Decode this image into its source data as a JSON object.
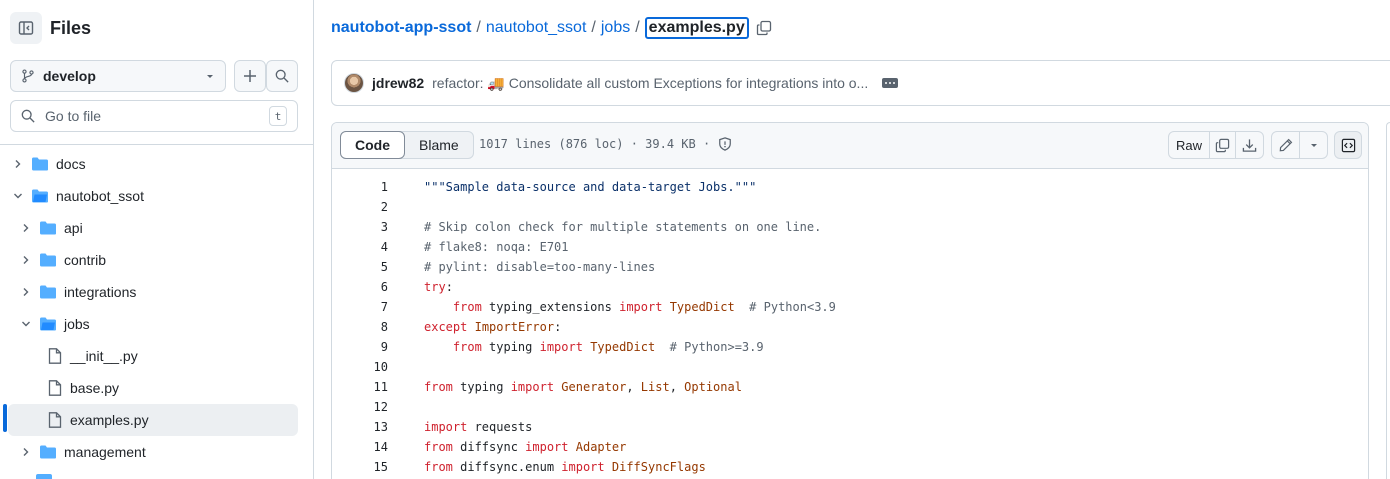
{
  "sidebar": {
    "title": "Files",
    "branch": "develop",
    "search_placeholder": "Go to file",
    "search_shortcut": "t",
    "tree": [
      {
        "label": "docs",
        "type": "folder",
        "expanded": false,
        "depth": 0
      },
      {
        "label": "nautobot_ssot",
        "type": "folder",
        "expanded": true,
        "depth": 0
      },
      {
        "label": "api",
        "type": "folder",
        "expanded": false,
        "depth": 1
      },
      {
        "label": "contrib",
        "type": "folder",
        "expanded": false,
        "depth": 1
      },
      {
        "label": "integrations",
        "type": "folder",
        "expanded": false,
        "depth": 1
      },
      {
        "label": "jobs",
        "type": "folder",
        "expanded": true,
        "depth": 1
      },
      {
        "label": "__init__.py",
        "type": "file",
        "depth": 2
      },
      {
        "label": "base.py",
        "type": "file",
        "depth": 2
      },
      {
        "label": "examples.py",
        "type": "file",
        "depth": 2,
        "selected": true
      },
      {
        "label": "management",
        "type": "folder",
        "expanded": false,
        "depth": 1
      }
    ]
  },
  "breadcrumb": {
    "repo": "nautobot-app-ssot",
    "sep": "/",
    "parts": [
      "nautobot_ssot",
      "jobs"
    ],
    "current": "examples.py"
  },
  "commit": {
    "author": "jdrew82",
    "message": "refactor: 🚚 Consolidate all custom Exceptions for integrations into o..."
  },
  "code_header": {
    "tab_code": "Code",
    "tab_blame": "Blame",
    "file_info": "1017 lines (876 loc) · 39.4 KB ·",
    "raw_label": "Raw"
  },
  "colors": {
    "accent": "#0969da",
    "keyword": "#cf222e",
    "class_name": "#953800",
    "string": "#0a3069",
    "comment": "#59636e"
  },
  "code": {
    "line_numbers": [
      "1",
      "2",
      "3",
      "4",
      "5",
      "6",
      "7",
      "8",
      "9",
      "10",
      "11",
      "12",
      "13",
      "14",
      "15"
    ],
    "lines": [
      [
        {
          "t": "\"\"\"Sample data-source and data-target Jobs.\"\"\"",
          "c": "str"
        }
      ],
      [],
      [
        {
          "t": "# Skip colon check for multiple statements on one line.",
          "c": "cmt"
        }
      ],
      [
        {
          "t": "# flake8: noqa: E701",
          "c": "cmt"
        }
      ],
      [
        {
          "t": "# pylint: disable=too-many-lines",
          "c": "cmt"
        }
      ],
      [
        {
          "t": "try",
          "c": "kw"
        },
        {
          "t": ":",
          "c": ""
        }
      ],
      [
        {
          "t": "    ",
          "c": ""
        },
        {
          "t": "from",
          "c": "kw"
        },
        {
          "t": " typing_extensions ",
          "c": ""
        },
        {
          "t": "import",
          "c": "kw"
        },
        {
          "t": " ",
          "c": ""
        },
        {
          "t": "TypedDict",
          "c": "cls"
        },
        {
          "t": "  # Python<3.9",
          "c": "cmt"
        }
      ],
      [
        {
          "t": "except",
          "c": "kw"
        },
        {
          "t": " ",
          "c": ""
        },
        {
          "t": "ImportError",
          "c": "cls"
        },
        {
          "t": ":",
          "c": ""
        }
      ],
      [
        {
          "t": "    ",
          "c": ""
        },
        {
          "t": "from",
          "c": "kw"
        },
        {
          "t": " typing ",
          "c": ""
        },
        {
          "t": "import",
          "c": "kw"
        },
        {
          "t": " ",
          "c": ""
        },
        {
          "t": "TypedDict",
          "c": "cls"
        },
        {
          "t": "  # Python>=3.9",
          "c": "cmt"
        }
      ],
      [],
      [
        {
          "t": "from",
          "c": "kw"
        },
        {
          "t": " typing ",
          "c": ""
        },
        {
          "t": "import",
          "c": "kw"
        },
        {
          "t": " ",
          "c": ""
        },
        {
          "t": "Generator",
          "c": "cls"
        },
        {
          "t": ", ",
          "c": ""
        },
        {
          "t": "List",
          "c": "cls"
        },
        {
          "t": ", ",
          "c": ""
        },
        {
          "t": "Optional",
          "c": "cls"
        }
      ],
      [],
      [
        {
          "t": "import",
          "c": "kw"
        },
        {
          "t": " requests",
          "c": ""
        }
      ],
      [
        {
          "t": "from",
          "c": "kw"
        },
        {
          "t": " diffsync ",
          "c": ""
        },
        {
          "t": "import",
          "c": "kw"
        },
        {
          "t": " ",
          "c": ""
        },
        {
          "t": "Adapter",
          "c": "cls"
        }
      ],
      [
        {
          "t": "from",
          "c": "kw"
        },
        {
          "t": " diffsync.enum ",
          "c": ""
        },
        {
          "t": "import",
          "c": "kw"
        },
        {
          "t": " ",
          "c": ""
        },
        {
          "t": "DiffSyncFlags",
          "c": "cls"
        }
      ]
    ]
  }
}
